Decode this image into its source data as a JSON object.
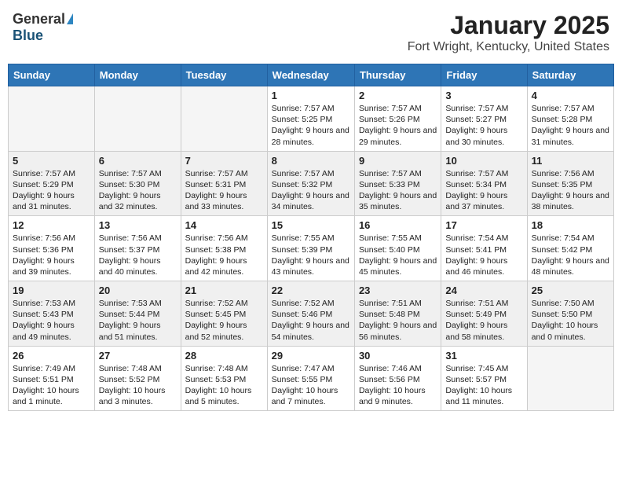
{
  "header": {
    "logo_general": "General",
    "logo_blue": "Blue",
    "title": "January 2025",
    "location": "Fort Wright, Kentucky, United States"
  },
  "weekdays": [
    "Sunday",
    "Monday",
    "Tuesday",
    "Wednesday",
    "Thursday",
    "Friday",
    "Saturday"
  ],
  "weeks": [
    {
      "shaded": false,
      "days": [
        {
          "num": "",
          "detail": ""
        },
        {
          "num": "",
          "detail": ""
        },
        {
          "num": "",
          "detail": ""
        },
        {
          "num": "1",
          "detail": "Sunrise: 7:57 AM\nSunset: 5:25 PM\nDaylight: 9 hours\nand 28 minutes."
        },
        {
          "num": "2",
          "detail": "Sunrise: 7:57 AM\nSunset: 5:26 PM\nDaylight: 9 hours\nand 29 minutes."
        },
        {
          "num": "3",
          "detail": "Sunrise: 7:57 AM\nSunset: 5:27 PM\nDaylight: 9 hours\nand 30 minutes."
        },
        {
          "num": "4",
          "detail": "Sunrise: 7:57 AM\nSunset: 5:28 PM\nDaylight: 9 hours\nand 31 minutes."
        }
      ]
    },
    {
      "shaded": true,
      "days": [
        {
          "num": "5",
          "detail": "Sunrise: 7:57 AM\nSunset: 5:29 PM\nDaylight: 9 hours\nand 31 minutes."
        },
        {
          "num": "6",
          "detail": "Sunrise: 7:57 AM\nSunset: 5:30 PM\nDaylight: 9 hours\nand 32 minutes."
        },
        {
          "num": "7",
          "detail": "Sunrise: 7:57 AM\nSunset: 5:31 PM\nDaylight: 9 hours\nand 33 minutes."
        },
        {
          "num": "8",
          "detail": "Sunrise: 7:57 AM\nSunset: 5:32 PM\nDaylight: 9 hours\nand 34 minutes."
        },
        {
          "num": "9",
          "detail": "Sunrise: 7:57 AM\nSunset: 5:33 PM\nDaylight: 9 hours\nand 35 minutes."
        },
        {
          "num": "10",
          "detail": "Sunrise: 7:57 AM\nSunset: 5:34 PM\nDaylight: 9 hours\nand 37 minutes."
        },
        {
          "num": "11",
          "detail": "Sunrise: 7:56 AM\nSunset: 5:35 PM\nDaylight: 9 hours\nand 38 minutes."
        }
      ]
    },
    {
      "shaded": false,
      "days": [
        {
          "num": "12",
          "detail": "Sunrise: 7:56 AM\nSunset: 5:36 PM\nDaylight: 9 hours\nand 39 minutes."
        },
        {
          "num": "13",
          "detail": "Sunrise: 7:56 AM\nSunset: 5:37 PM\nDaylight: 9 hours\nand 40 minutes."
        },
        {
          "num": "14",
          "detail": "Sunrise: 7:56 AM\nSunset: 5:38 PM\nDaylight: 9 hours\nand 42 minutes."
        },
        {
          "num": "15",
          "detail": "Sunrise: 7:55 AM\nSunset: 5:39 PM\nDaylight: 9 hours\nand 43 minutes."
        },
        {
          "num": "16",
          "detail": "Sunrise: 7:55 AM\nSunset: 5:40 PM\nDaylight: 9 hours\nand 45 minutes."
        },
        {
          "num": "17",
          "detail": "Sunrise: 7:54 AM\nSunset: 5:41 PM\nDaylight: 9 hours\nand 46 minutes."
        },
        {
          "num": "18",
          "detail": "Sunrise: 7:54 AM\nSunset: 5:42 PM\nDaylight: 9 hours\nand 48 minutes."
        }
      ]
    },
    {
      "shaded": true,
      "days": [
        {
          "num": "19",
          "detail": "Sunrise: 7:53 AM\nSunset: 5:43 PM\nDaylight: 9 hours\nand 49 minutes."
        },
        {
          "num": "20",
          "detail": "Sunrise: 7:53 AM\nSunset: 5:44 PM\nDaylight: 9 hours\nand 51 minutes."
        },
        {
          "num": "21",
          "detail": "Sunrise: 7:52 AM\nSunset: 5:45 PM\nDaylight: 9 hours\nand 52 minutes."
        },
        {
          "num": "22",
          "detail": "Sunrise: 7:52 AM\nSunset: 5:46 PM\nDaylight: 9 hours\nand 54 minutes."
        },
        {
          "num": "23",
          "detail": "Sunrise: 7:51 AM\nSunset: 5:48 PM\nDaylight: 9 hours\nand 56 minutes."
        },
        {
          "num": "24",
          "detail": "Sunrise: 7:51 AM\nSunset: 5:49 PM\nDaylight: 9 hours\nand 58 minutes."
        },
        {
          "num": "25",
          "detail": "Sunrise: 7:50 AM\nSunset: 5:50 PM\nDaylight: 10 hours\nand 0 minutes."
        }
      ]
    },
    {
      "shaded": false,
      "days": [
        {
          "num": "26",
          "detail": "Sunrise: 7:49 AM\nSunset: 5:51 PM\nDaylight: 10 hours\nand 1 minute."
        },
        {
          "num": "27",
          "detail": "Sunrise: 7:48 AM\nSunset: 5:52 PM\nDaylight: 10 hours\nand 3 minutes."
        },
        {
          "num": "28",
          "detail": "Sunrise: 7:48 AM\nSunset: 5:53 PM\nDaylight: 10 hours\nand 5 minutes."
        },
        {
          "num": "29",
          "detail": "Sunrise: 7:47 AM\nSunset: 5:55 PM\nDaylight: 10 hours\nand 7 minutes."
        },
        {
          "num": "30",
          "detail": "Sunrise: 7:46 AM\nSunset: 5:56 PM\nDaylight: 10 hours\nand 9 minutes."
        },
        {
          "num": "31",
          "detail": "Sunrise: 7:45 AM\nSunset: 5:57 PM\nDaylight: 10 hours\nand 11 minutes."
        },
        {
          "num": "",
          "detail": ""
        }
      ]
    }
  ]
}
